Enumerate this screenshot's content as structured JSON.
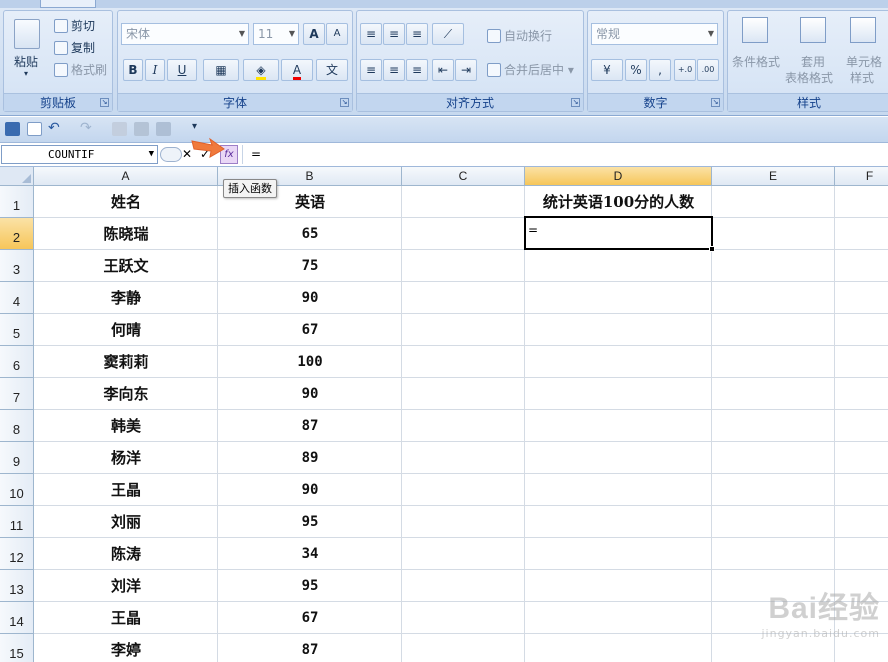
{
  "ribbon": {
    "clipboard": {
      "group_label": "剪贴板",
      "paste": "粘贴",
      "cut": "剪切",
      "copy": "复制",
      "format_painter": "格式刷"
    },
    "font": {
      "group_label": "字体",
      "font_name": "宋体",
      "font_size": "11",
      "grow": "A",
      "shrink": "A",
      "bold": "B",
      "italic": "I",
      "underline": "U",
      "font_color": "A"
    },
    "alignment": {
      "group_label": "对齐方式",
      "wrap_text": "自动换行",
      "merge_center": "合并后居中"
    },
    "number": {
      "group_label": "数字",
      "format": "常规",
      "percent": "%",
      "comma": ","
    },
    "styles": {
      "group_label": "样式",
      "conditional": "条件格式",
      "table_format_1": "套用",
      "table_format_2": "表格格式",
      "cell_styles_1": "单元格",
      "cell_styles_2": "样式"
    }
  },
  "formula_bar": {
    "name_box": "COUNTIF",
    "formula": "=",
    "tooltip": "插入函数",
    "cancel_glyph": "✕",
    "enter_glyph": "✓",
    "fx_glyph": "fx"
  },
  "grid": {
    "columns": [
      "A",
      "B",
      "C",
      "D",
      "E",
      "F"
    ],
    "rows": [
      "1",
      "2",
      "3",
      "4",
      "5",
      "6",
      "7",
      "8",
      "9",
      "10",
      "11",
      "12",
      "13",
      "14",
      "15"
    ],
    "header_a": "姓名",
    "header_b": "英语",
    "header_d": "统计英语100分的人数",
    "active_cell_value": "=",
    "names": [
      "陈晓瑞",
      "王跃文",
      "李静",
      "何晴",
      "窦莉莉",
      "李向东",
      "韩美",
      "杨洋",
      "王晶",
      "刘丽",
      "陈涛",
      "刘洋",
      "王晶",
      "李婷"
    ],
    "english": [
      "65",
      "75",
      "90",
      "67",
      "100",
      "90",
      "87",
      "89",
      "90",
      "95",
      "34",
      "95",
      "67",
      "87"
    ]
  },
  "watermark": {
    "line1": "Bai经验",
    "line2": "jingyan.baidu.com"
  },
  "colors": {
    "selected_header": "#f6c65a",
    "ribbon": "#c7d9ef",
    "gridline": "#d4dbe4"
  }
}
